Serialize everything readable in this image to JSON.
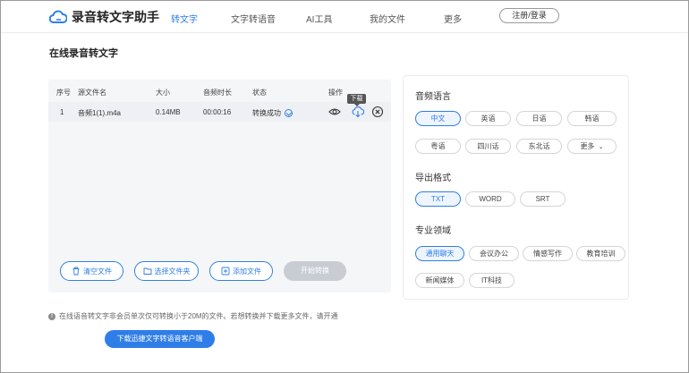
{
  "header": {
    "app_name": "录音转文字助手",
    "nav": [
      "转文字",
      "文字转语音",
      "AI工具",
      "我的文件",
      "更多"
    ],
    "login": "注册/登录"
  },
  "main": {
    "title": "在线录音转文字",
    "table": {
      "headers": [
        "序号",
        "源文件名",
        "大小",
        "音频时长",
        "状态",
        "操作"
      ],
      "rows": [
        {
          "index": "1",
          "name": "音频1(1).m4a",
          "size": "0.14MB",
          "duration": "00:00:16",
          "status": "转换成功"
        }
      ]
    },
    "tooltip": "下载",
    "buttons": {
      "clear": "清空文件",
      "choose_folder": "选择文件夹",
      "add_file": "添加文件",
      "start": "开始转换"
    }
  },
  "options": {
    "language_title": "音频语言",
    "languages": [
      "中文",
      "英语",
      "日语",
      "韩语",
      "粤语",
      "四川话",
      "东北话",
      "更多"
    ],
    "format_title": "导出格式",
    "formats": [
      "TXT",
      "WORD",
      "SRT"
    ],
    "domain_title": "专业领域",
    "domains": [
      "通用聊天",
      "会议办公",
      "情感写作",
      "教育培训",
      "新闻媒体",
      "IT科技"
    ]
  },
  "notice": "在线语音转文字非会员单次仅可转换小于20M的文件。若想转换并下载更多文件，请开通",
  "download_client": "下载迅捷文字转语音客户端",
  "colors": {
    "accent": "#2f7ee8",
    "disabled": "#c9cdd3"
  }
}
